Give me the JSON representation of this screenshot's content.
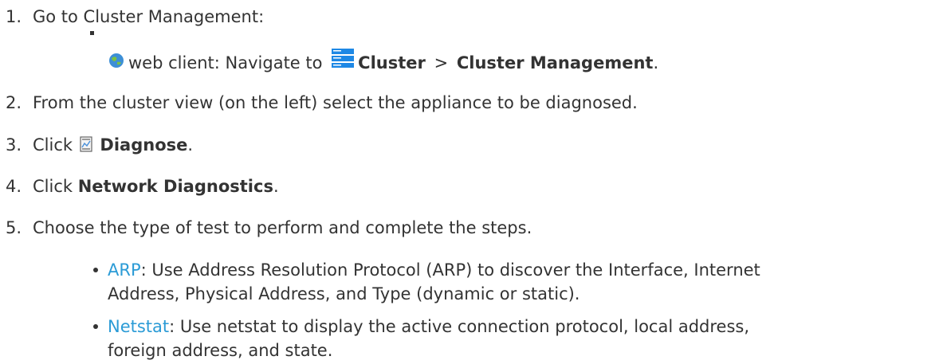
{
  "steps": [
    {
      "number": "1.",
      "text": "Go to Cluster Management:"
    },
    {
      "number": "2.",
      "text": "From the cluster view (on the left) select the appliance to be diagnosed."
    },
    {
      "number": "3.",
      "pre": "Click",
      "bold": "Diagnose",
      "post": "."
    },
    {
      "number": "4.",
      "pre": "Click",
      "bold": "Network Diagnostics",
      "post": "."
    },
    {
      "number": "5.",
      "text": "Choose the type of test to perform and complete the steps."
    }
  ],
  "web_client": {
    "pre": "web client: Navigate to",
    "bold1": "Cluster",
    "sep": ">",
    "bold2": "Cluster Management",
    "post": "."
  },
  "options": [
    {
      "link": "ARP",
      "line1": ": Use Address Resolution Protocol (ARP) to discover the Interface, Internet",
      "line2": "Address, Physical Address, and Type (dynamic or static)."
    },
    {
      "link": "Netstat",
      "line1": ": Use netstat to display the active connection protocol, local address,",
      "line2": "foreign address, and state."
    }
  ],
  "icons": {
    "globe": "globe-icon",
    "cluster": "cluster-icon",
    "diagnose": "diagnose-icon"
  },
  "colors": {
    "text": "#333333",
    "link": "#2b9bd6",
    "icon_blue": "#1e88e5"
  }
}
